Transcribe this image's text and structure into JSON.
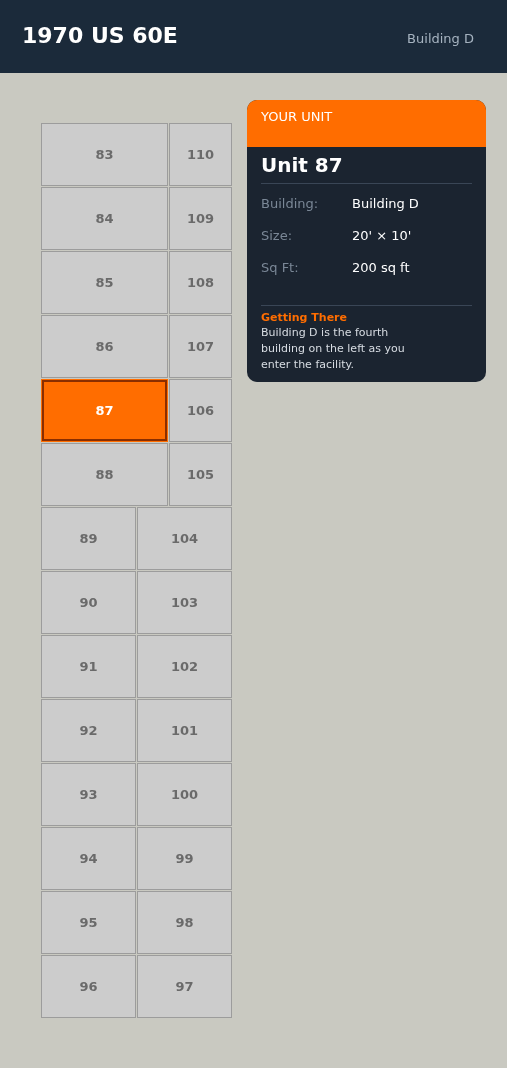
{
  "header": {
    "title": "1970 US 60E",
    "building": "Building D"
  },
  "rows": [
    {
      "kind": "wide-left",
      "units": [
        {
          "label": "83",
          "selected": false
        },
        {
          "label": "110",
          "selected": false
        }
      ]
    },
    {
      "kind": "wide-left",
      "units": [
        {
          "label": "84",
          "selected": false
        },
        {
          "label": "109",
          "selected": false
        }
      ]
    },
    {
      "kind": "wide-left",
      "units": [
        {
          "label": "85",
          "selected": false
        },
        {
          "label": "108",
          "selected": false
        }
      ]
    },
    {
      "kind": "wide-left",
      "units": [
        {
          "label": "86",
          "selected": false
        },
        {
          "label": "107",
          "selected": false
        }
      ]
    },
    {
      "kind": "wide-left",
      "units": [
        {
          "label": "87",
          "selected": true
        },
        {
          "label": "106",
          "selected": false
        }
      ]
    },
    {
      "kind": "wide-left",
      "units": [
        {
          "label": "88",
          "selected": false
        },
        {
          "label": "105",
          "selected": false
        }
      ]
    },
    {
      "kind": "even",
      "units": [
        {
          "label": "89",
          "selected": false
        },
        {
          "label": "104",
          "selected": false
        }
      ]
    },
    {
      "kind": "even",
      "units": [
        {
          "label": "90",
          "selected": false
        },
        {
          "label": "103",
          "selected": false
        }
      ]
    },
    {
      "kind": "even",
      "units": [
        {
          "label": "91",
          "selected": false
        },
        {
          "label": "102",
          "selected": false
        }
      ]
    },
    {
      "kind": "even",
      "units": [
        {
          "label": "92",
          "selected": false
        },
        {
          "label": "101",
          "selected": false
        }
      ]
    },
    {
      "kind": "even",
      "units": [
        {
          "label": "93",
          "selected": false
        },
        {
          "label": "100",
          "selected": false
        }
      ]
    },
    {
      "kind": "even",
      "units": [
        {
          "label": "94",
          "selected": false
        },
        {
          "label": "99",
          "selected": false
        }
      ]
    },
    {
      "kind": "even",
      "units": [
        {
          "label": "95",
          "selected": false
        },
        {
          "label": "98",
          "selected": false
        }
      ]
    },
    {
      "kind": "even",
      "units": [
        {
          "label": "96",
          "selected": false
        },
        {
          "label": "97",
          "selected": false
        }
      ]
    }
  ],
  "card": {
    "badge": "YOUR UNIT",
    "title": "Unit 87",
    "details": [
      {
        "label": "Building:",
        "value": "Building D"
      },
      {
        "label": "Size:",
        "value": "20' × 10'"
      },
      {
        "label": "Sq Ft:",
        "value": "200 sq ft"
      }
    ],
    "directions_title": "Getting There",
    "directions": "Building D is the fourth building on the left as you enter the facility."
  }
}
